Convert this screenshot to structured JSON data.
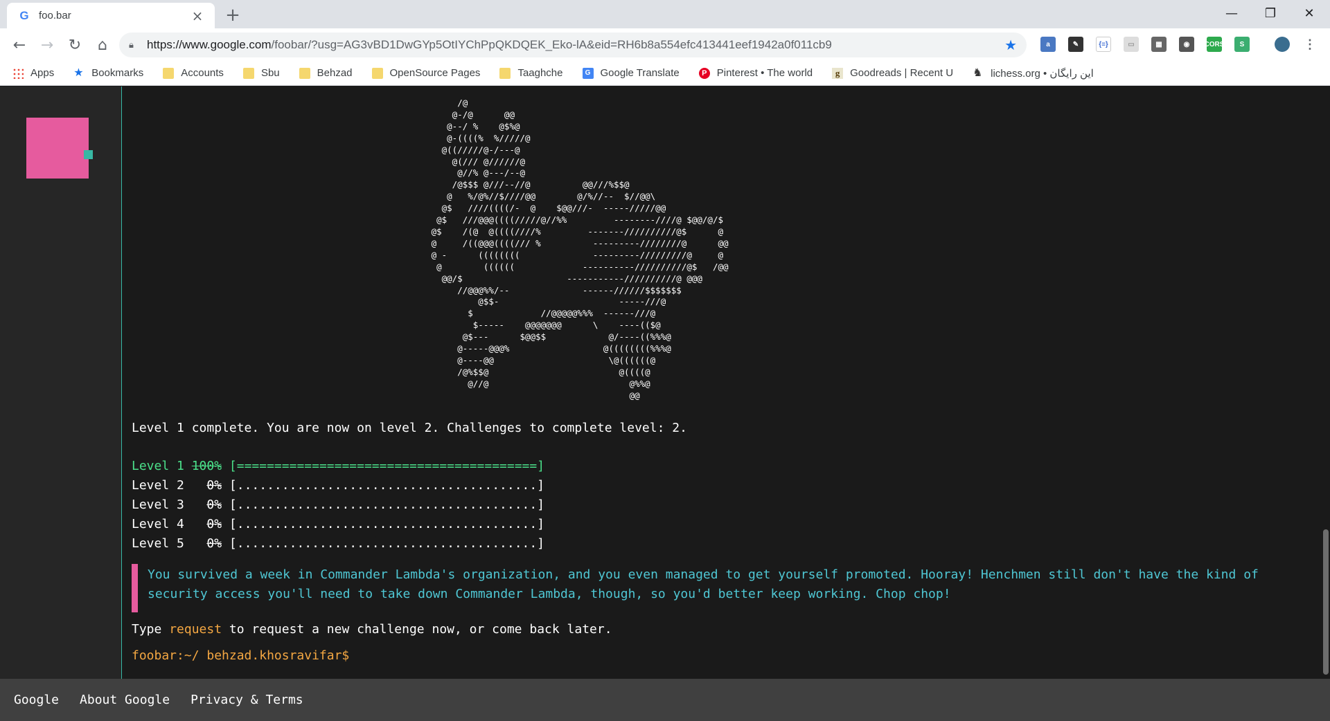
{
  "browser": {
    "tab_title": "foo.bar",
    "url_prefix": "https://www.google.com",
    "url_path": "/foobar/?usg=AG3vBD1DwGYp5OtIYChPpQKDQEK_Eko-lA&eid=RH6b8a554efc413441eef1942a0f011cb9",
    "bookmarks": [
      {
        "label": "Apps",
        "icon": "apps-grid-icon"
      },
      {
        "label": "Bookmarks",
        "icon": "star-icon"
      },
      {
        "label": "Accounts",
        "icon": "folder-icon"
      },
      {
        "label": "Sbu",
        "icon": "folder-icon"
      },
      {
        "label": "Behzad",
        "icon": "folder-icon"
      },
      {
        "label": "OpenSource Pages",
        "icon": "folder-icon"
      },
      {
        "label": "Taaghche",
        "icon": "folder-icon"
      },
      {
        "label": "Google Translate",
        "icon": "translate-icon"
      },
      {
        "label": "Pinterest • The world",
        "icon": "pinterest-icon"
      },
      {
        "label": "Goodreads | Recent U",
        "icon": "goodreads-icon"
      },
      {
        "label": "lichess.org • اين رايگان",
        "icon": "chess-knight-icon"
      }
    ]
  },
  "terminal": {
    "ascii_art": "        /@\n       @-/@      @@\n      @--/ %    @$%@\n      @-((((%  %/////@\n     @((/////@-/---@\n       @(/// @//////@\n        @//% @---/--@\n       /@$$$ @///--//@          @@///%$$@\n      @   %/@%//$////@@        @/%//--  $//@@\\\n     @$   ////((((/-  @    $@@///-  -----/////@@\n    @$   ///@@@((((/////@//%%         --------////@ $@@/@/$\n   @$    /(@  @((((////%         -------//////////@$      @\n   @     /((@@@((((/// %          ---------////////@      @@\n   @ -      ((((((((              ---------/////////@     @\n    @        ((((((             ----------//////////@$   /@@\n     @@/$                    -----------//////////@ @@@\n        //@@@%%/--              ------//////$$$$$$$\n            @$$-                       -----///@\n          $             //@@@@@%%%  ------///@\n           $-----    @@@@@@@      \\    ----(($@\n         @$---      $@@$$            @/----((%%%@\n        @-----@@@%                  @((((((((%%%@\n        @----@@                      \\@((((((@\n        /@%$$@                         @((((@\n          @//@                           @%%@\n                                         @@",
    "status_line": "Level 1 complete. You are now on level 2. Challenges to complete level: 2.",
    "levels": [
      {
        "label": "Level 1",
        "percent_text": "100%",
        "bar": "[========================================]",
        "progress": 1.0
      },
      {
        "label": "Level 2",
        "percent_text": "0%",
        "bar": "[........................................]",
        "progress": 0.0
      },
      {
        "label": "Level 3",
        "percent_text": "0%",
        "bar": "[........................................]",
        "progress": 0.0
      },
      {
        "label": "Level 4",
        "percent_text": "0%",
        "bar": "[........................................]",
        "progress": 0.0
      },
      {
        "label": "Level 5",
        "percent_text": "0%",
        "bar": "[........................................]",
        "progress": 0.0
      }
    ],
    "message": "You survived a week in Commander Lambda's organization, and you even managed to get yourself promoted. Hooray! Henchmen still don't have the kind of security access you'll need to take down Commander Lambda, though, so you'd better keep working. Chop chop!",
    "instruction_before": "Type ",
    "instruction_keyword": "request",
    "instruction_after": " to request a new challenge now, or come back later.",
    "prompt": "foobar:~/ behzad.khosravifar$"
  },
  "footer": {
    "links": [
      "Google",
      "About Google",
      "Privacy & Terms"
    ]
  },
  "colors": {
    "accent_pink": "#e65b9e",
    "accent_teal": "#37b9a7",
    "green": "#4be08a",
    "cyan_text": "#4fc7d4",
    "orange": "#f4a742"
  }
}
